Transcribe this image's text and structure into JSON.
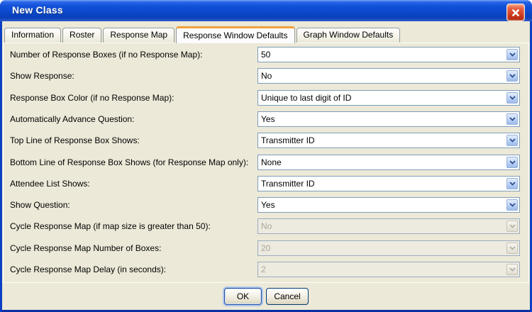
{
  "window": {
    "title": "New Class"
  },
  "icons": {
    "close-icon": "✕",
    "chevron-down-icon": "▾"
  },
  "colors": {
    "titlebar_blue": "#0D49CE",
    "window_border_blue": "#0B3FC4",
    "dialog_bg": "#ECE9D8",
    "active_tab_stripe": "#F0A13C",
    "combo_border": "#7F9DB9",
    "combo_button_blue": "#B5CEF4",
    "close_button_red": "#CE3A1F",
    "disabled_text": "#A9A79B"
  },
  "tabs": [
    {
      "label": "Information",
      "active": false
    },
    {
      "label": "Roster",
      "active": false
    },
    {
      "label": "Response Map",
      "active": false
    },
    {
      "label": "Response Window Defaults",
      "active": true
    },
    {
      "label": "Graph Window Defaults",
      "active": false
    }
  ],
  "form": {
    "rows": [
      {
        "label": "Number of Response Boxes (if no Response Map):",
        "value": "50",
        "disabled": false
      },
      {
        "label": "Show Response:",
        "value": "No",
        "disabled": false
      },
      {
        "label": "Response Box Color (if no Response Map):",
        "value": "Unique to last digit of ID",
        "disabled": false
      },
      {
        "label": "Automatically Advance Question:",
        "value": "Yes",
        "disabled": false
      },
      {
        "label": "Top Line of Response Box Shows:",
        "value": "Transmitter ID",
        "disabled": false
      },
      {
        "label": "Bottom Line of Response Box Shows (for Response Map only):",
        "value": "None",
        "disabled": false
      },
      {
        "label": "Attendee List Shows:",
        "value": "Transmitter ID",
        "disabled": false
      },
      {
        "label": "Show Question:",
        "value": "Yes",
        "disabled": false
      },
      {
        "label": "Cycle Response Map (if map size is greater than 50):",
        "value": "No",
        "disabled": true
      },
      {
        "label": "Cycle Response Map Number of Boxes:",
        "value": "20",
        "disabled": true
      },
      {
        "label": "Cycle Response Map Delay (in seconds):",
        "value": "2",
        "disabled": true
      }
    ]
  },
  "buttons": {
    "ok": "OK",
    "cancel": "Cancel"
  }
}
